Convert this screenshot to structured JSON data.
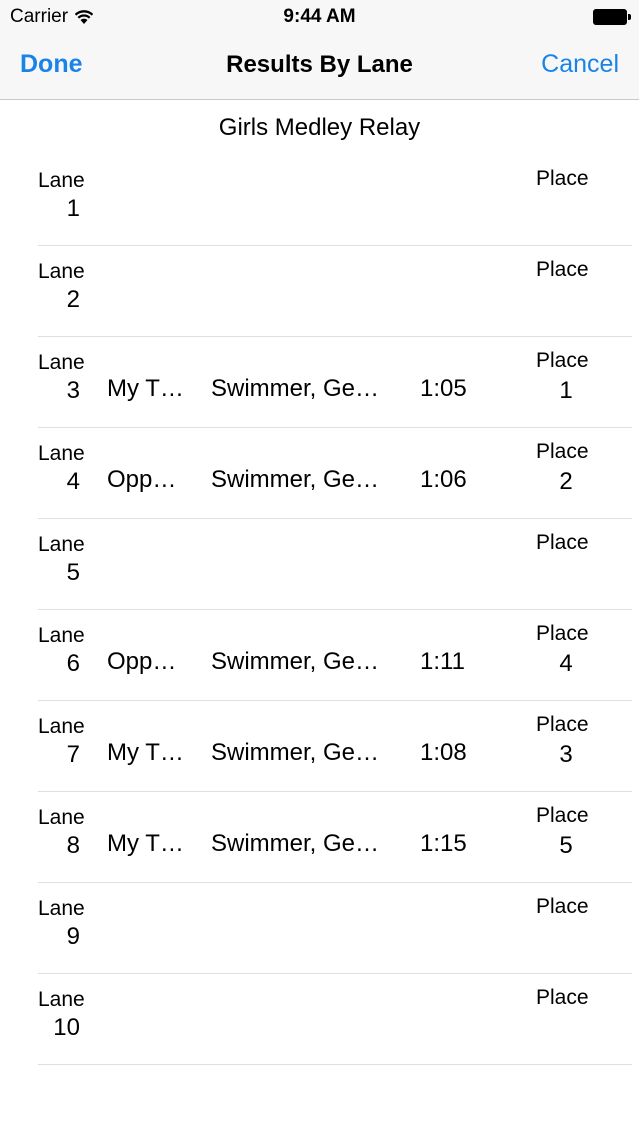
{
  "status_bar": {
    "carrier": "Carrier",
    "time": "9:44 AM"
  },
  "nav": {
    "done_label": "Done",
    "title": "Results By Lane",
    "cancel_label": "Cancel"
  },
  "event_title": "Girls Medley Relay",
  "labels": {
    "lane": "Lane",
    "place": "Place"
  },
  "lanes": [
    {
      "lane": "1",
      "team": "",
      "swimmer": "",
      "time": "",
      "place": ""
    },
    {
      "lane": "2",
      "team": "",
      "swimmer": "",
      "time": "",
      "place": ""
    },
    {
      "lane": "3",
      "team": "My T…",
      "swimmer": "Swimmer, Ge…",
      "time": "1:05",
      "place": "1"
    },
    {
      "lane": "4",
      "team": "Opp…",
      "swimmer": "Swimmer, Ge…",
      "time": "1:06",
      "place": "2"
    },
    {
      "lane": "5",
      "team": "",
      "swimmer": "",
      "time": "",
      "place": ""
    },
    {
      "lane": "6",
      "team": "Opp…",
      "swimmer": "Swimmer, Ge…",
      "time": "1:11",
      "place": "4"
    },
    {
      "lane": "7",
      "team": "My T…",
      "swimmer": "Swimmer, Ge…",
      "time": "1:08",
      "place": "3"
    },
    {
      "lane": "8",
      "team": "My T…",
      "swimmer": "Swimmer, Ge…",
      "time": "1:15",
      "place": "5"
    },
    {
      "lane": "9",
      "team": "",
      "swimmer": "",
      "time": "",
      "place": ""
    },
    {
      "lane": "10",
      "team": "",
      "swimmer": "",
      "time": "",
      "place": ""
    }
  ],
  "colors": {
    "accent": "#1a83e8",
    "nav_background": "#f7f7f7",
    "separator": "#e0e0e0"
  }
}
